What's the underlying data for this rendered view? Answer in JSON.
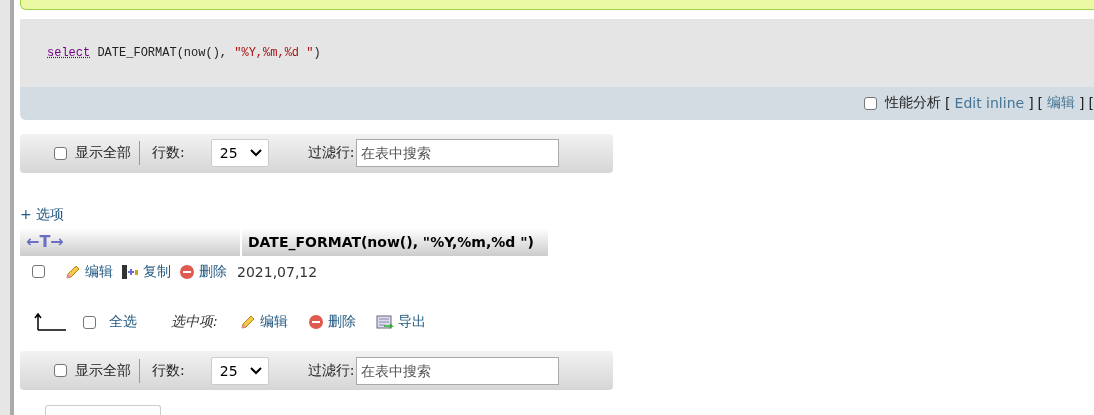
{
  "sql": {
    "keyword": "select",
    "expression": "DATE_FORMAT(now(), ",
    "string": "\"%Y,%m,%d \"",
    "close": ")"
  },
  "query_bar": {
    "profiling": {
      "label": "性能分析",
      "checked": false
    },
    "items": [
      {
        "kind": "bracket",
        "text": "["
      },
      {
        "kind": "link",
        "text": "Edit inline"
      },
      {
        "kind": "bracket",
        "text": "]"
      },
      {
        "kind": "bracket",
        "text": "["
      },
      {
        "kind": "link",
        "text": "编辑"
      },
      {
        "kind": "bracket",
        "text": "]"
      },
      {
        "kind": "bracket",
        "text": "["
      }
    ]
  },
  "toolbars": [
    {
      "show_all": {
        "label": "显示全部",
        "checked": false
      },
      "rows_label": "行数:",
      "rows_value": "25",
      "filter_label": "过滤行:",
      "filter_placeholder": "在表中搜索"
    },
    {
      "show_all": {
        "label": "显示全部",
        "checked": false
      },
      "rows_label": "行数:",
      "rows_value": "25",
      "filter_label": "过滤行:",
      "filter_placeholder": "在表中搜索"
    }
  ],
  "options_link": "+ 选项",
  "table": {
    "sort_arrows": "←T→",
    "columns": [
      "DATE_FORMAT(now(), \"%Y,%m,%d \")"
    ],
    "rows": [
      {
        "checked": false,
        "actions": [
          {
            "kind": "edit",
            "label": "编辑"
          },
          {
            "kind": "copy",
            "label": "复制"
          },
          {
            "kind": "delete",
            "label": "删除"
          }
        ],
        "cells": [
          "2021,07,12"
        ]
      }
    ]
  },
  "bulk": {
    "select_all": {
      "label": "全选",
      "checked": false
    },
    "with_selected": "选中项:",
    "actions": [
      {
        "kind": "edit",
        "label": "编辑"
      },
      {
        "kind": "delete",
        "label": "删除"
      },
      {
        "kind": "export",
        "label": "导出"
      }
    ]
  }
}
